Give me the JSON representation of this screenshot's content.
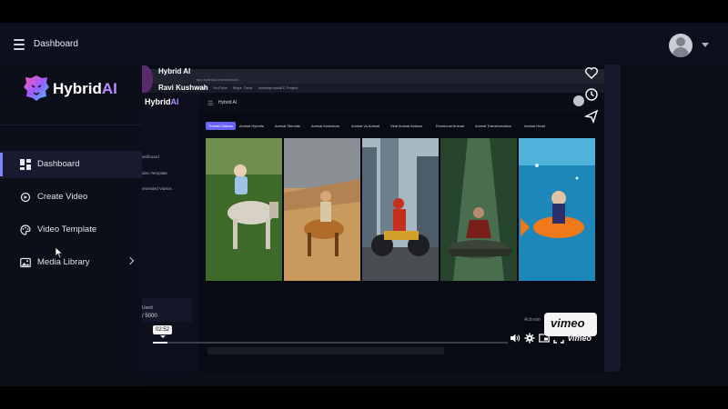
{
  "header": {
    "title": "Dashboard"
  },
  "brand": {
    "name": "Hybrid",
    "suffix": "AI"
  },
  "sidebar": {
    "items": [
      {
        "label": "Dashboard",
        "icon": "grid-icon",
        "active": true
      },
      {
        "label": "Create Video",
        "icon": "video-plus-icon"
      },
      {
        "label": "Video Template",
        "icon": "palette-icon"
      },
      {
        "label": "Media Library",
        "icon": "image-icon",
        "has_submenu": true
      }
    ]
  },
  "player": {
    "title": "Hybrid AI",
    "author": "Ravi Kushwah",
    "timestamp": "02:52",
    "progress": 0.04,
    "brand_word": "vimeo",
    "badge_word": "vimeo"
  },
  "inner": {
    "header_title": "Hybrid AI",
    "logo": "Hybrid",
    "logo_suffix": "AI",
    "nav": [
      "ashboard",
      "ideo Template",
      "enerated Videos"
    ],
    "tabs": [
      "Trained Videos",
      "Animal Hybrids",
      "Animal Steroids",
      "Animal Ancestors",
      "Animal Vs Animal",
      "Viral Animal Actions",
      "Emotional Animal",
      "Animal Transformation",
      "Animal Head"
    ],
    "usage_label": "Used",
    "usage_value": "/ 5000",
    "activate": "Activate",
    "bookmarks": [
      "Gmail",
      "YouTube",
      "Maps",
      "Drive",
      "adamsproudct",
      "CC Project"
    ],
    "url": "app.hybridai.io/dashboard"
  },
  "colors": {
    "accent": "#7d86ff",
    "brand_ai": "#b98cff",
    "tab_active": "#6b63ff"
  }
}
